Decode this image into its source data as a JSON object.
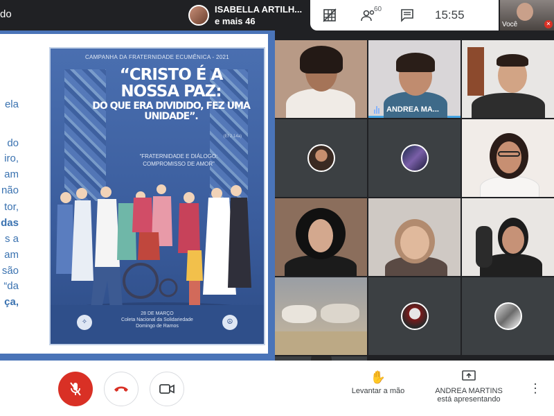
{
  "header": {
    "title_fragment": "do",
    "presenter_name": "ISABELLA ARTILH...",
    "presenter_others": "e mais 46",
    "participants_count": "60",
    "clock": "15:55",
    "self_label": "Você"
  },
  "slide": {
    "side_text": [
      "ela",
      "do",
      "iro,",
      "am",
      "não",
      "tor,",
      "das",
      "s a",
      "am",
      "são",
      "“da",
      "ça,"
    ],
    "poster": {
      "campaign": "CAMPANHA DA FRATERNIDADE ECUMÊNICA - 2021",
      "quote_main": "“CRISTO É A NOSSA PAZ:",
      "quote_sub": "DO QUE ERA DIVIDIDO, FEZ UMA UNIDADE”.",
      "reference": "(Ef 2.14a)",
      "subtitle": "“FRATERNIDADE E DIÁLOGO: COMPROMISSO DE AMOR”",
      "date": "28 DE MARÇO",
      "collect": "Coleta Nacional da Solidariedade",
      "sunday": "Domingo de Ramos"
    }
  },
  "tiles": {
    "speaker_name": "ANDREA MA..."
  },
  "controls": {
    "raise_hand": "Levantar a mão",
    "presenter_line1": "ANDREA MARTINS",
    "presenter_line2": "está apresentando"
  },
  "colors": {
    "accent_red": "#d93025",
    "slide_blue": "#4a74b8",
    "text_blue": "#3a72b0",
    "dark_bg": "#202124"
  }
}
